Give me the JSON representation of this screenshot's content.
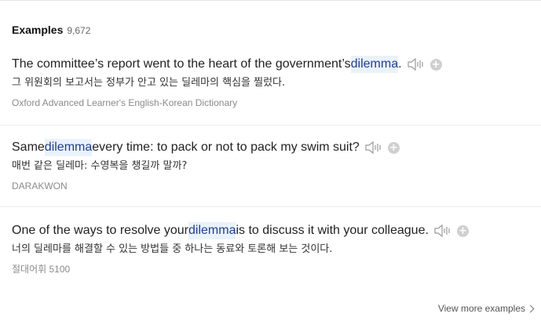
{
  "header": {
    "title": "Examples",
    "count": "9,672"
  },
  "examples": [
    {
      "before": "The committee’s report went to the heart of the government’s ",
      "highlight": "dilemma",
      "after": ".",
      "translation": "그 위원회의 보고서는 정부가 안고 있는 딜레마의 핵심을 찔렀다.",
      "source": "Oxford Advanced Learner's English-Korean Dictionary"
    },
    {
      "before": "Same ",
      "highlight": "dilemma",
      "after": " every time: to pack or not to pack my swim suit?",
      "translation": "매번 같은 딜레마: 수영복을 챙길까 말까?",
      "source": "DARAKWON"
    },
    {
      "before": "One of the ways to resolve your ",
      "highlight": "dilemma",
      "after": " is to discuss it with your colleague.",
      "translation": "너의 딜레마를 해결할 수 있는 방법들 중 하나는 동료와 토론해 보는 것이다.",
      "source": "절대어휘 5100"
    }
  ],
  "icons": {
    "speaker": "speaker-icon",
    "add": "plus-circle-icon",
    "chevron": "chevron-right-icon"
  },
  "add_glyph": "+",
  "view_more": "View more examples",
  "colors": {
    "highlight_bg": "#eaf2fb",
    "highlight_text": "#1f3f8f",
    "icon_gray": "#cfcfcf"
  }
}
